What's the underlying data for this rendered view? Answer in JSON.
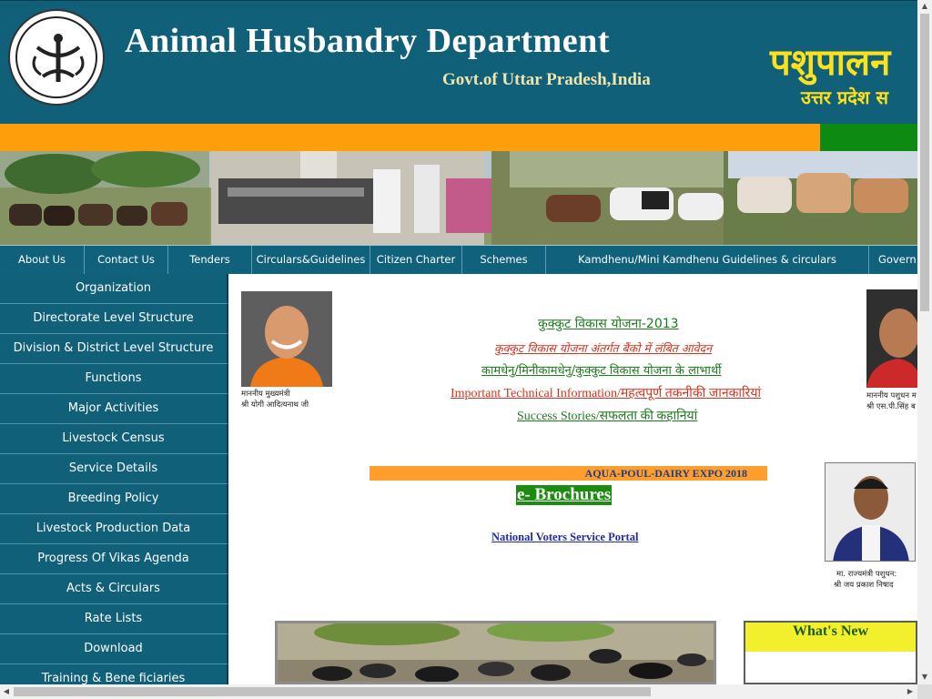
{
  "header": {
    "title": "Animal Husbandry Department",
    "subtitle": "Govt.of Uttar Pradesh,India",
    "hindi_title": "पशुपालन",
    "hindi_subtitle": "उत्तर प्रदेश स",
    "logo_icon": "uttar-pradesh-emblem-icon",
    "colors": {
      "header_bg": "#11607a",
      "orange": "#ff9e0b",
      "green": "#0d8a12",
      "hindi": "#ffe11a"
    }
  },
  "topnav": {
    "items": [
      {
        "label": "About Us"
      },
      {
        "label": "Contact Us"
      },
      {
        "label": "Tenders"
      },
      {
        "label": "Circulars&Guidelines"
      },
      {
        "label": "Citizen Charter"
      },
      {
        "label": "Schemes"
      },
      {
        "label": "Kamdhenu/Mini Kamdhenu Guidelines & circulars"
      },
      {
        "label": "Govern"
      }
    ]
  },
  "sidebar": {
    "items": [
      {
        "label": "Organization"
      },
      {
        "label": "Directorate Level Structure"
      },
      {
        "label": "Division & District Level Structure"
      },
      {
        "label": "Functions"
      },
      {
        "label": "Major Activities"
      },
      {
        "label": "Livestock Census"
      },
      {
        "label": "Service Details"
      },
      {
        "label": "Breeding Policy"
      },
      {
        "label": "Livestock Production Data"
      },
      {
        "label": "Progress Of Vikas Agenda"
      },
      {
        "label": "Acts & Circulars"
      },
      {
        "label": "Rate Lists"
      },
      {
        "label": "Download"
      },
      {
        "label": "Training & Bene ficiaries"
      }
    ]
  },
  "main": {
    "cm_caption_line1": "माननीय मुख्यमंत्री",
    "cm_caption_line2": "श्री योगी आदित्यनाथ जी",
    "minister_caption_line1": "माननीय पशुधन म",
    "minister_caption_line2": "श्री एस.पी.सिंह ब",
    "state_minister_caption_line1": "मा. राज्यमंत्री पशुधन:",
    "state_minister_caption_line2": "श्री जय प्रकाश निषाद",
    "links": {
      "kukkut_yojana": "कुक्कुट विकास योजना-2013",
      "kukkut_pending": "कुक्कुट विकास योजना अंतर्गत बैंको में लंबित आवेदन",
      "beneficiaries": "कामधेनु/मिनीकामधेनु/कुक्कुट विकास योजना के लाभार्थी",
      "technical_info": "Important Technical Information/महत्वपूर्ण तकनीकी जानकारियां",
      "success_stories": "Success Stories/सफलता की कहानियां"
    },
    "expo": "AQUA-POUL-DAIRY EXPO 2018",
    "brochures": "e- Brochures",
    "voters_portal": "National Voters Service Portal",
    "whats_new": "What's New"
  }
}
